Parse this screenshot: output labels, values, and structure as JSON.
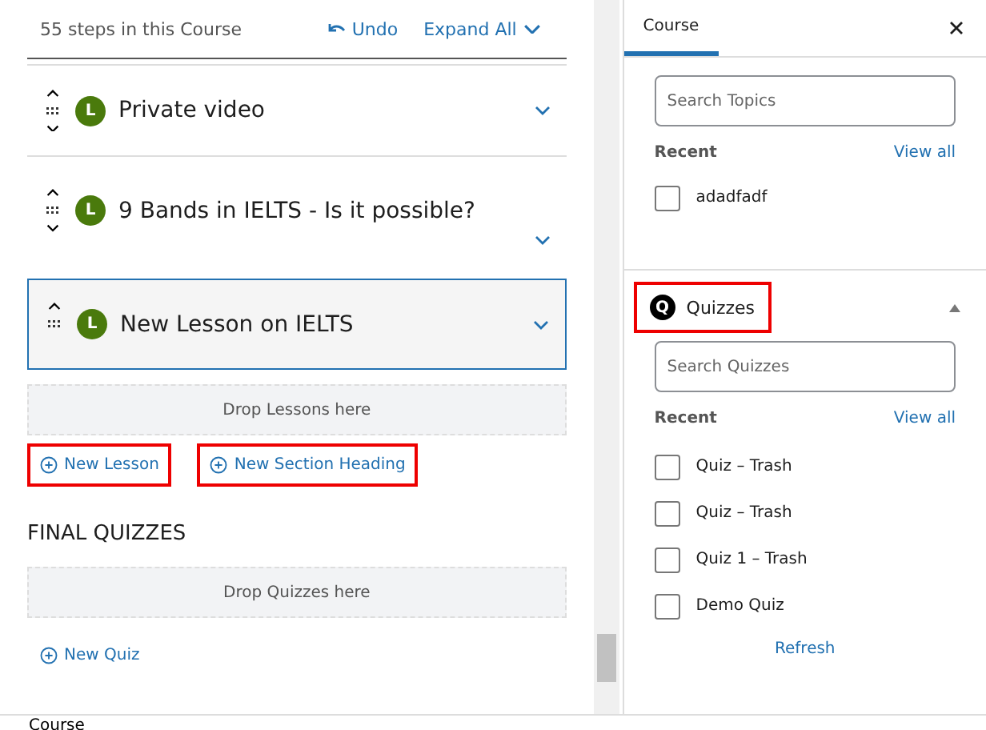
{
  "builder": {
    "steps": "55 steps in this Course",
    "undo": "Undo",
    "expand_all": "Expand All",
    "lessons": [
      {
        "badge": "L",
        "title": "Private video",
        "selected": false,
        "can_move_down": true
      },
      {
        "badge": "L",
        "title": "9 Bands in IELTS - Is it possible?",
        "selected": false,
        "can_move_down": true
      },
      {
        "badge": "L",
        "title": "New Lesson on IELTS",
        "selected": true,
        "can_move_down": false
      }
    ],
    "drop_lessons": "Drop Lessons here",
    "actions": [
      {
        "label": "New Lesson",
        "highlighted": true
      },
      {
        "label": "New Section Heading",
        "highlighted": true
      }
    ],
    "final_heading": "FINAL QUIZZES",
    "drop_quizzes": "Drop Quizzes here",
    "new_quiz": {
      "label": "New Quiz",
      "highlighted": false
    }
  },
  "sidebar": {
    "tab": "Course",
    "topics": {
      "placeholder": "Search Topics",
      "recent": "Recent",
      "view_all": "View all",
      "items": [
        {
          "label": "adadfadf",
          "checked": false
        }
      ]
    },
    "quizzes": {
      "badge": "Q",
      "title": "Quizzes",
      "outlined_in_red": true,
      "expanded": true,
      "placeholder": "Search Quizzes",
      "recent": "Recent",
      "view_all": "View all",
      "items": [
        {
          "label": "Quiz – Trash",
          "checked": false
        },
        {
          "label": "Quiz – Trash",
          "checked": false
        },
        {
          "label": "Quiz 1 – Trash",
          "checked": false
        },
        {
          "label": "Demo Quiz",
          "checked": false
        }
      ],
      "refresh": "Refresh"
    }
  },
  "footer": "Course"
}
